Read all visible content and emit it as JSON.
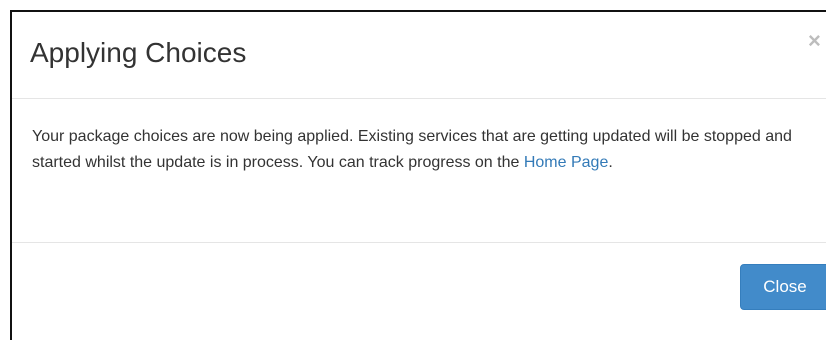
{
  "dialog": {
    "title": "Applying Choices",
    "close_symbol": "×",
    "body": {
      "text": "Your package choices are now being applied. Existing services that are getting updated will be stopped and started whilst the update is in process. You can track progress on the ",
      "link_text": "Home Page",
      "after_link": "."
    },
    "close_button_label": "Close"
  },
  "colors": {
    "primary": "#428bca",
    "link": "#337ab7",
    "text": "#333333",
    "divider": "#e5e5e5"
  },
  "icons": {
    "dismiss": "close-icon"
  }
}
